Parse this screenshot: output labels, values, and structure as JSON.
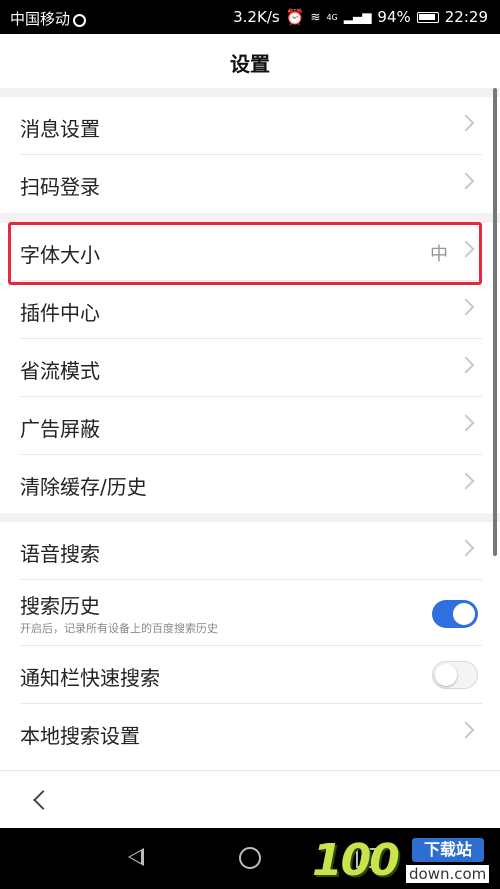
{
  "status_bar": {
    "carrier": "中国移动",
    "speed": "3.2K/s",
    "network": "4G",
    "battery": "94%",
    "time": "22:29"
  },
  "header": {
    "title": "设置"
  },
  "groups": [
    {
      "items": [
        {
          "label": "消息设置",
          "control": "chevron"
        },
        {
          "label": "扫码登录",
          "control": "chevron"
        }
      ]
    },
    {
      "items": [
        {
          "label": "字体大小",
          "value": "中",
          "control": "chevron",
          "highlighted": true
        },
        {
          "label": "插件中心",
          "control": "chevron"
        },
        {
          "label": "省流模式",
          "control": "chevron"
        },
        {
          "label": "广告屏蔽",
          "control": "chevron"
        },
        {
          "label": "清除缓存/历史",
          "control": "chevron"
        }
      ]
    },
    {
      "items": [
        {
          "label": "语音搜索",
          "control": "chevron"
        },
        {
          "label": "搜索历史",
          "sublabel": "开启后，记录所有设备上的百度搜索历史",
          "control": "toggle",
          "toggle_on": true
        },
        {
          "label": "通知栏快速搜索",
          "control": "toggle",
          "toggle_on": false
        },
        {
          "label": "本地搜索设置",
          "control": "chevron"
        }
      ]
    }
  ],
  "colors": {
    "toggle_on": "#2f6fe0",
    "highlight_border": "#e8263c"
  },
  "watermark": {
    "number": "100",
    "badge": "下载站",
    "url": "down.com"
  }
}
